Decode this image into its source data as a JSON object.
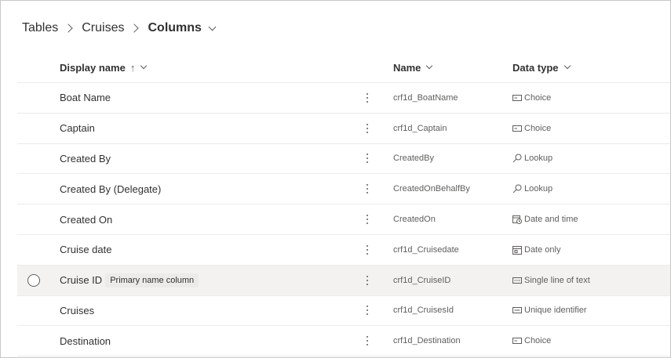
{
  "breadcrumb": {
    "items": [
      "Tables",
      "Cruises"
    ],
    "current": "Columns"
  },
  "headers": {
    "display_name": "Display name",
    "sort_arrow": "↑",
    "name": "Name",
    "data_type": "Data type"
  },
  "rows": [
    {
      "display": "Boat Name",
      "logical": "crf1d_BoatName",
      "type": "Choice",
      "type_icon": "choice-icon"
    },
    {
      "display": "Captain",
      "logical": "crf1d_Captain",
      "type": "Choice",
      "type_icon": "choice-icon"
    },
    {
      "display": "Created By",
      "logical": "CreatedBy",
      "type": "Lookup",
      "type_icon": "lookup-icon"
    },
    {
      "display": "Created By (Delegate)",
      "logical": "CreatedOnBehalfBy",
      "type": "Lookup",
      "type_icon": "lookup-icon"
    },
    {
      "display": "Created On",
      "logical": "CreatedOn",
      "type": "Date and time",
      "type_icon": "date-time-icon"
    },
    {
      "display": "Cruise date",
      "logical": "crf1d_Cruisedate",
      "type": "Date only",
      "type_icon": "calendar-icon"
    },
    {
      "display": "Cruise ID",
      "logical": "crf1d_CruiseID",
      "type": "Single line of text",
      "type_icon": "text-field-icon",
      "badge": "Primary name column",
      "selected": true
    },
    {
      "display": "Cruises",
      "logical": "crf1d_CruisesId",
      "type": "Unique identifier",
      "type_icon": "id-icon"
    },
    {
      "display": "Destination",
      "logical": "crf1d_Destination",
      "type": "Choice",
      "type_icon": "choice-icon"
    }
  ],
  "colors": {
    "selected_row": "#f3f2f1",
    "divider": "#edebe9",
    "muted_text": "#605e5c"
  }
}
